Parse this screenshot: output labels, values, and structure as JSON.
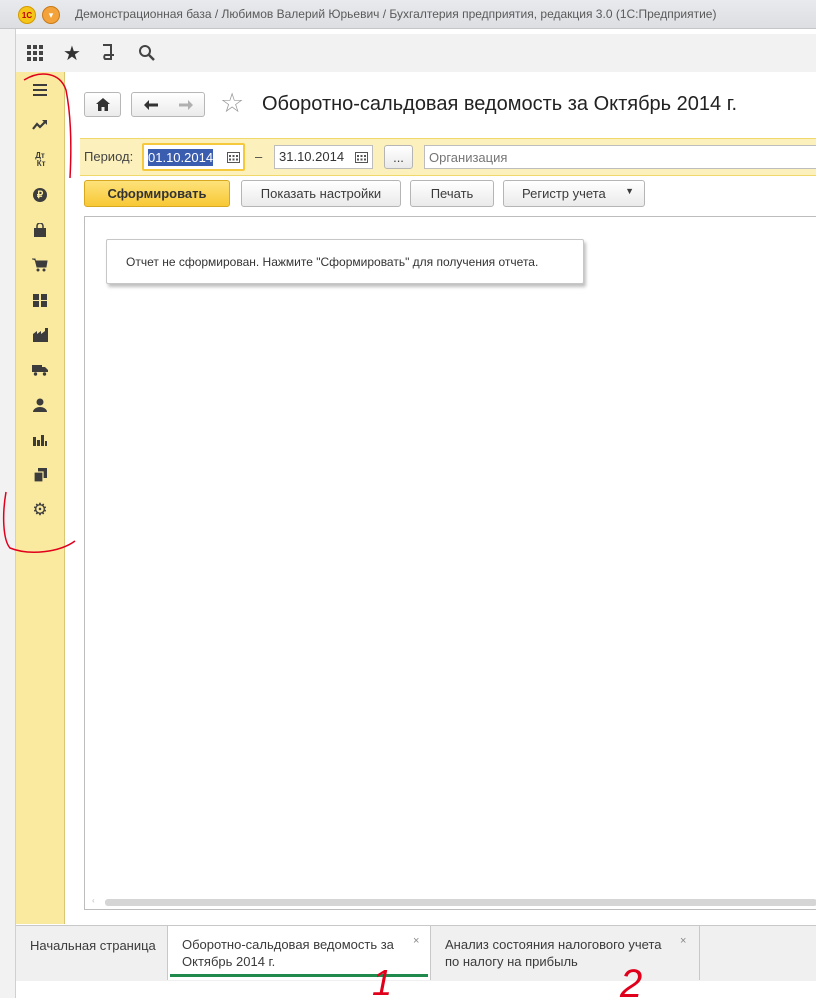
{
  "window": {
    "title": "Демонстрационная база / Любимов Валерий Юрьевич / Бухгалтерия предприятия, редакция 3.0  (1С:Предприятие)"
  },
  "toolbar": {
    "icons": [
      "apps-grid-icon",
      "star-icon",
      "history-icon",
      "search-icon"
    ]
  },
  "sidebar": {
    "items": [
      {
        "icon": "menu-icon",
        "glyph": "≡"
      },
      {
        "icon": "trend-icon",
        "glyph": "↗"
      },
      {
        "icon": "dt-kt-icon",
        "glyph": "ДтКт"
      },
      {
        "icon": "ruble-icon",
        "glyph": "₽"
      },
      {
        "icon": "shopping-bag-icon",
        "glyph": "⛟"
      },
      {
        "icon": "cart-icon",
        "glyph": "🛒"
      },
      {
        "icon": "warehouse-icon",
        "glyph": "▦"
      },
      {
        "icon": "factory-icon",
        "glyph": "▙"
      },
      {
        "icon": "truck-icon",
        "glyph": "⛟"
      },
      {
        "icon": "person-icon",
        "glyph": "●"
      },
      {
        "icon": "bar-chart-icon",
        "glyph": "▮"
      },
      {
        "icon": "documents-icon",
        "glyph": "▤"
      },
      {
        "icon": "gear-icon",
        "glyph": "⚙"
      }
    ]
  },
  "header": {
    "title": "Оборотно-сальдовая ведомость за Октябрь 2014 г."
  },
  "period": {
    "label": "Период:",
    "from": "01.10.2014",
    "dash": "–",
    "to": "31.10.2014",
    "more_label": "...",
    "org_placeholder": "Организация"
  },
  "actions": {
    "generate": "Сформировать",
    "show_settings": "Показать настройки",
    "print": "Печать",
    "register": "Регистр учета"
  },
  "report": {
    "message": "Отчет не сформирован. Нажмите \"Сформировать\" для получения отчета."
  },
  "tabs": [
    {
      "label": "Начальная страница"
    },
    {
      "label_line1": "Оборотно-сальдовая ведомость за",
      "label_line2": "Октябрь 2014 г.",
      "close": "×"
    },
    {
      "label_line1": "Анализ состояния налогового учета",
      "label_line2": "по налогу на прибыль",
      "close": "×"
    }
  ],
  "annotations": [
    "1",
    "2"
  ],
  "colors": {
    "sidebar_bg": "#faeaa0",
    "accent_yellow": "#fbd34a",
    "active_tab_underline": "#1f8a4c",
    "annotation_red": "#e0001b"
  }
}
